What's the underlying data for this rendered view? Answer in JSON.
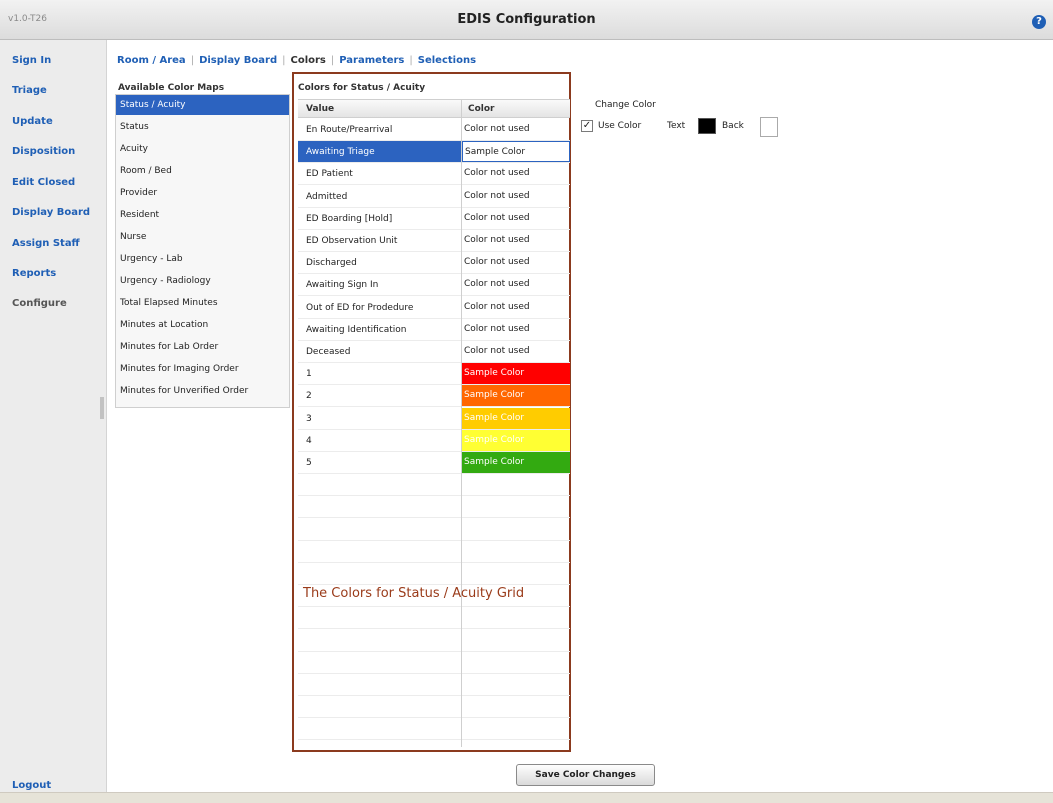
{
  "header": {
    "version": "v1.0-T26",
    "title": "EDIS Configuration",
    "help_icon": "?"
  },
  "sidebar": {
    "items": [
      {
        "label": "Sign In"
      },
      {
        "label": "Triage"
      },
      {
        "label": "Update"
      },
      {
        "label": "Disposition"
      },
      {
        "label": "Edit Closed"
      },
      {
        "label": "Display Board"
      },
      {
        "label": "Assign Staff"
      },
      {
        "label": "Reports"
      },
      {
        "label": "Configure"
      }
    ],
    "logout": "Logout"
  },
  "tabs": [
    {
      "label": "Room / Area"
    },
    {
      "label": "Display Board"
    },
    {
      "label": "Colors"
    },
    {
      "label": "Parameters"
    },
    {
      "label": "Selections"
    }
  ],
  "color_maps": {
    "header": "Available Color Maps",
    "items": [
      "Status / Acuity",
      "Status",
      "Acuity",
      "Room / Bed",
      "Provider",
      "Resident",
      "Nurse",
      "Urgency - Lab",
      "Urgency - Radiology",
      "Total Elapsed Minutes",
      "Minutes at Location",
      "Minutes for Lab Order",
      "Minutes for Imaging Order",
      "Minutes for Unverified Order"
    ],
    "selected": "Status / Acuity"
  },
  "grid": {
    "title": "Colors for Status / Acuity",
    "columns": [
      "Value",
      "Color"
    ],
    "rows": [
      {
        "value": "En Route/Prearrival",
        "color": "Color not used"
      },
      {
        "value": "Awaiting Triage",
        "color": "Sample Color",
        "selected": true
      },
      {
        "value": "ED Patient",
        "color": "Color not used"
      },
      {
        "value": "Admitted",
        "color": "Color not used"
      },
      {
        "value": "ED Boarding [Hold]",
        "color": "Color not used"
      },
      {
        "value": "ED Observation Unit",
        "color": "Color not used"
      },
      {
        "value": "Discharged",
        "color": "Color not used"
      },
      {
        "value": "Awaiting Sign In",
        "color": "Color not used"
      },
      {
        "value": "Out of ED for Prodedure",
        "color": "Color not used"
      },
      {
        "value": "Awaiting Identification",
        "color": "Color not used"
      },
      {
        "value": "Deceased",
        "color": "Color not used"
      },
      {
        "value": "1",
        "color": "Sample Color",
        "bg": "#ff0000"
      },
      {
        "value": "2",
        "color": "Sample Color",
        "bg": "#ff6600"
      },
      {
        "value": "3",
        "color": "Sample Color",
        "bg": "#ffcc00"
      },
      {
        "value": "4",
        "color": "Sample Color",
        "bg": "#ffff33"
      },
      {
        "value": "5",
        "color": "Sample Color",
        "bg": "#33aa11"
      }
    ],
    "annotation": "The Colors for Status / Acuity Grid"
  },
  "change_color": {
    "label": "Change Color",
    "use_color_checked": true,
    "use_color_label": "Use Color",
    "text_label": "Text",
    "text_color": "#000000",
    "back_label": "Back",
    "back_color": "#ffffff"
  },
  "save_button": "Save Color Changes"
}
